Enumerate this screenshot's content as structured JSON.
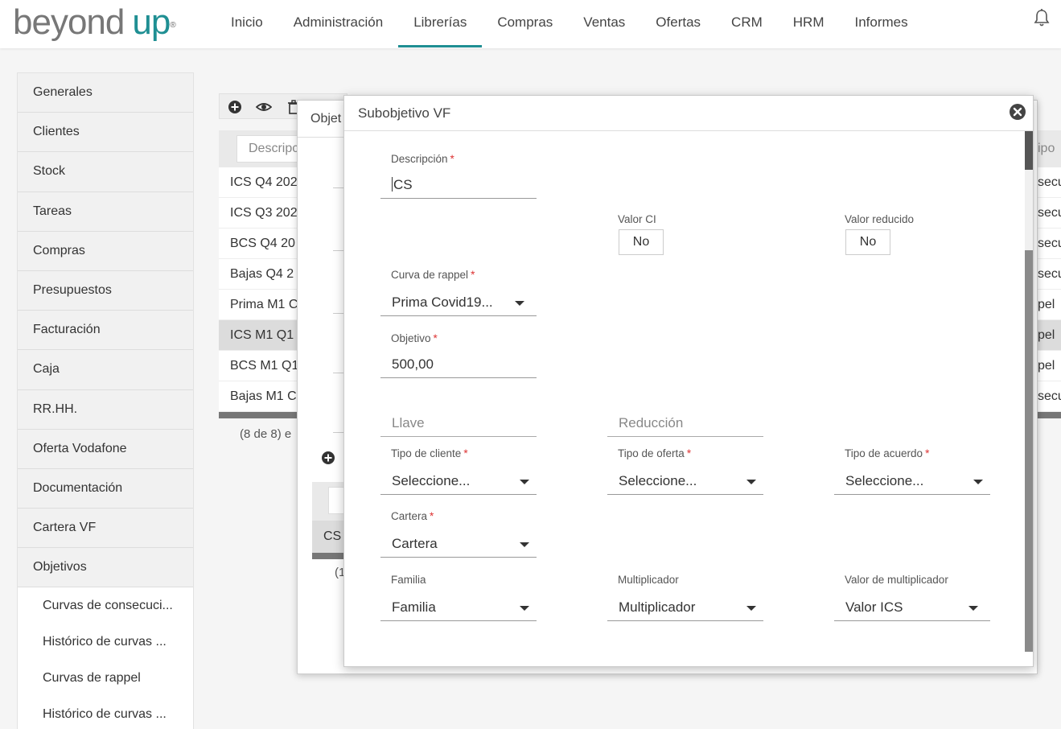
{
  "header": {
    "logo_text": "beyond",
    "logo_accent": "up",
    "logo_mark": "®",
    "nav": [
      {
        "label": "Inicio"
      },
      {
        "label": "Administración"
      },
      {
        "label": "Librerías"
      },
      {
        "label": "Compras"
      },
      {
        "label": "Ventas"
      },
      {
        "label": "Ofertas"
      },
      {
        "label": "CRM"
      },
      {
        "label": "HRM"
      },
      {
        "label": "Informes"
      }
    ],
    "active_nav": "Librerías",
    "accent_color": "#1f8f93"
  },
  "sidebar": {
    "items": [
      {
        "label": "Generales"
      },
      {
        "label": "Clientes"
      },
      {
        "label": "Stock"
      },
      {
        "label": "Tareas"
      },
      {
        "label": "Compras"
      },
      {
        "label": "Presupuestos"
      },
      {
        "label": "Facturación"
      },
      {
        "label": "Caja"
      },
      {
        "label": "RR.HH."
      },
      {
        "label": "Oferta Vodafone"
      },
      {
        "label": "Documentación"
      },
      {
        "label": "Cartera VF"
      },
      {
        "label": "Objetivos"
      }
    ],
    "subitems": [
      {
        "label": "Curvas de consecuci..."
      },
      {
        "label": "Histórico de curvas ..."
      },
      {
        "label": "Curvas de rappel"
      },
      {
        "label": "Histórico de curvas ..."
      }
    ]
  },
  "background": {
    "search_placeholder": "Descripc",
    "rows": [
      {
        "text": "ICS Q4 202",
        "right": "secu"
      },
      {
        "text": "ICS Q3 202",
        "right": "secu"
      },
      {
        "text": "BCS Q4 20",
        "right": "secu"
      },
      {
        "text": "Bajas Q4 2",
        "right": "secu"
      },
      {
        "text": "Prima M1 C",
        "right": "pel"
      },
      {
        "text": "ICS M1 Q1",
        "right": "pel"
      },
      {
        "text": "BCS M1 Q1",
        "right": "pel"
      },
      {
        "text": "Bajas M1 C",
        "right": "secu"
      }
    ],
    "right_header": "ipo c",
    "count_text": "(8 de 8) e"
  },
  "parent_dialog": {
    "title": "Objet",
    "sub_row": "CS",
    "sub_count": "(1"
  },
  "dialog": {
    "title": "Subobjetivo VF",
    "descripcion": {
      "label": "Descripción",
      "value": "CS"
    },
    "valor_ci": {
      "label": "Valor CI",
      "value": "No"
    },
    "valor_reducido": {
      "label": "Valor reducido",
      "value": "No"
    },
    "curva_rappel": {
      "label": "Curva de rappel",
      "value": "Prima Covid19..."
    },
    "objetivo": {
      "label": "Objetivo",
      "value": "500,00"
    },
    "llave": {
      "placeholder": "Llave"
    },
    "reduccion": {
      "placeholder": "Reducción"
    },
    "tipo_cliente": {
      "label": "Tipo de cliente",
      "value": "Seleccione..."
    },
    "tipo_oferta": {
      "label": "Tipo de oferta",
      "value": "Seleccione..."
    },
    "tipo_acuerdo": {
      "label": "Tipo de acuerdo",
      "value": "Seleccione..."
    },
    "cartera": {
      "label": "Cartera",
      "value": "Cartera"
    },
    "familia": {
      "label": "Familia",
      "value": "Familia"
    },
    "multiplicador": {
      "label": "Multiplicador",
      "value": "Multiplicador"
    },
    "valor_multiplicador": {
      "label": "Valor de multiplicador",
      "value": "Valor ICS"
    },
    "required_marker": "*"
  }
}
